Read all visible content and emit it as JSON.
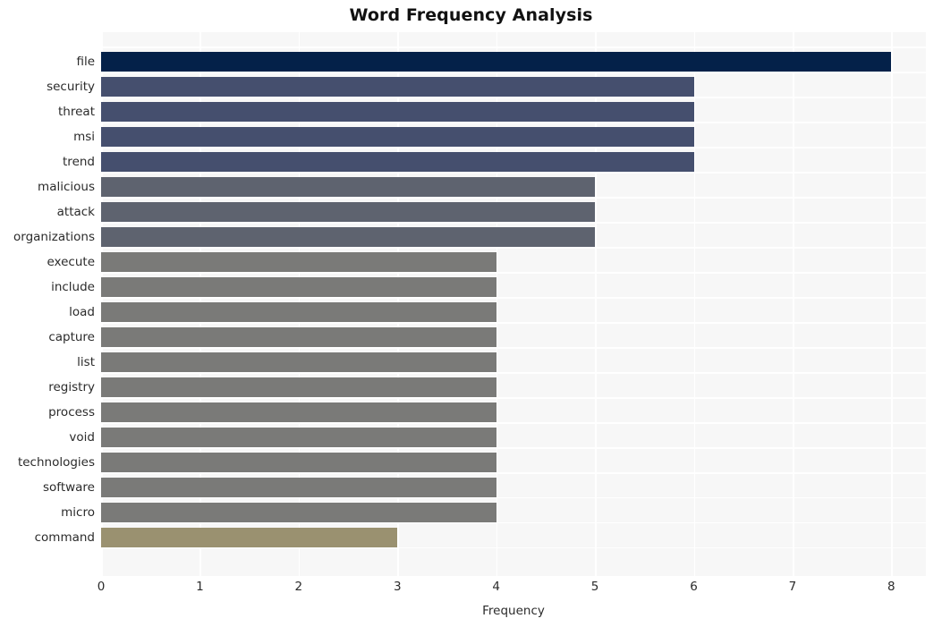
{
  "chart_data": {
    "type": "bar",
    "orientation": "horizontal",
    "title": "Word Frequency Analysis",
    "xlabel": "Frequency",
    "ylabel": "",
    "categories": [
      "file",
      "security",
      "threat",
      "msi",
      "trend",
      "malicious",
      "attack",
      "organizations",
      "execute",
      "include",
      "load",
      "capture",
      "list",
      "registry",
      "process",
      "void",
      "technologies",
      "software",
      "micro",
      "command"
    ],
    "values": [
      8,
      6,
      6,
      6,
      6,
      5,
      5,
      5,
      4,
      4,
      4,
      4,
      4,
      4,
      4,
      4,
      4,
      4,
      4,
      3
    ],
    "bar_colors": [
      "#042149",
      "#454f6e",
      "#454f6e",
      "#454f6e",
      "#454f6e",
      "#5e636f",
      "#5e636f",
      "#5e636f",
      "#7a7a78",
      "#7a7a78",
      "#7a7a78",
      "#7a7a78",
      "#7a7a78",
      "#7a7a78",
      "#7a7a78",
      "#7a7a78",
      "#7a7a78",
      "#7a7a78",
      "#7a7a78",
      "#9a9170"
    ],
    "xlim": [
      0,
      8.35
    ],
    "xticks": [
      0,
      1,
      2,
      3,
      4,
      5,
      6,
      7,
      8
    ],
    "xtick_labels": [
      "0",
      "1",
      "2",
      "3",
      "4",
      "5",
      "6",
      "7",
      "8"
    ],
    "grid": true,
    "grid_color": "#ffffff",
    "plot_background": "#f7f7f7",
    "figure_background": "#ffffff",
    "legend": null
  }
}
